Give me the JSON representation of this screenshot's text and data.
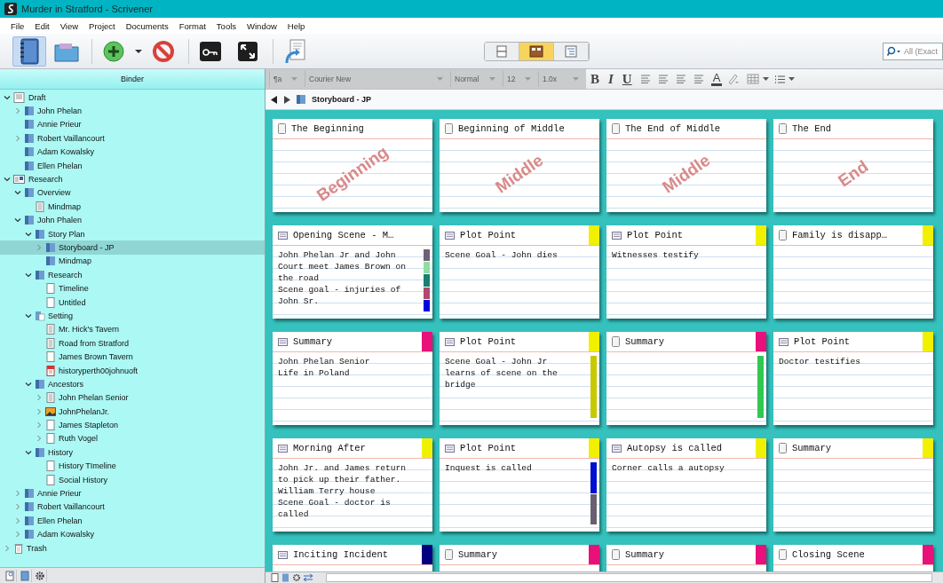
{
  "window": {
    "title": "Murder in Stratford - Scrivener"
  },
  "menu": [
    "File",
    "Edit",
    "View",
    "Project",
    "Documents",
    "Format",
    "Tools",
    "Window",
    "Help"
  ],
  "toolbar": {
    "tools": [
      {
        "kind": "binder",
        "selected": true
      },
      {
        "kind": "collections",
        "selected": false
      },
      {
        "kind": "add",
        "selected": false
      },
      {
        "kind": "caret",
        "selected": false
      },
      {
        "kind": "delete",
        "selected": false
      },
      {
        "kind": "keywords",
        "selected": false
      },
      {
        "kind": "fullscreen",
        "selected": false
      },
      {
        "kind": "compile",
        "selected": false
      }
    ],
    "view_modes": [
      {
        "kind": "scrivenings",
        "selected": false
      },
      {
        "kind": "corkboard",
        "selected": true
      },
      {
        "kind": "outliner",
        "selected": false
      }
    ],
    "search": {
      "placeholder": "All (Exact"
    }
  },
  "format_bar": {
    "paragraph": "¶a",
    "font": "Courier New",
    "style": "Normal",
    "size": "12",
    "spacing": "1.0x",
    "bold": "B",
    "italic": "I",
    "underline": "U",
    "text_color": "A"
  },
  "binder": {
    "title": "Binder",
    "items": [
      {
        "label": "Draft",
        "kind": "draft",
        "expanded": true,
        "selected": false,
        "children": [
          {
            "label": "John Phelan",
            "kind": "folder",
            "expanded": false,
            "selected": false
          },
          {
            "label": "Annie Prieur",
            "kind": "folder",
            "selected": false
          },
          {
            "label": "Robert Vaillancourt",
            "kind": "folder",
            "expanded": false,
            "selected": false
          },
          {
            "label": "Adam Kowalsky",
            "kind": "folder",
            "selected": false
          },
          {
            "label": "Ellen Phelan",
            "kind": "folder",
            "selected": false
          }
        ]
      },
      {
        "label": "Research",
        "kind": "research",
        "expanded": true,
        "selected": false,
        "children": [
          {
            "label": "Overview",
            "kind": "folder",
            "expanded": true,
            "selected": false,
            "children": [
              {
                "label": "Mindmap",
                "kind": "text",
                "selected": false
              }
            ]
          },
          {
            "label": "John Phalen",
            "kind": "folder",
            "expanded": true,
            "selected": false,
            "children": [
              {
                "label": "Story Plan",
                "kind": "folder",
                "expanded": true,
                "selected": false,
                "children": [
                  {
                    "label": "Storyboard - JP",
                    "kind": "folder",
                    "expanded": false,
                    "selected": true
                  },
                  {
                    "label": "Mindmap",
                    "kind": "folder",
                    "selected": false
                  }
                ]
              },
              {
                "label": "Research",
                "kind": "folder",
                "expanded": true,
                "selected": false,
                "children": [
                  {
                    "label": "Timeline",
                    "kind": "page",
                    "selected": false
                  },
                  {
                    "label": "Untitled",
                    "kind": "page",
                    "selected": false
                  }
                ]
              },
              {
                "label": "Setting",
                "kind": "textfolder",
                "expanded": true,
                "selected": false,
                "children": [
                  {
                    "label": "Mr. Hick's Tavern",
                    "kind": "text",
                    "selected": false
                  },
                  {
                    "label": "Road from Stratford",
                    "kind": "text",
                    "selected": false
                  },
                  {
                    "label": "James Brown Tavern",
                    "kind": "page",
                    "selected": false
                  },
                  {
                    "label": "historyperth00johnuoft",
                    "kind": "pdf",
                    "selected": false
                  }
                ]
              },
              {
                "label": "Ancestors",
                "kind": "folder",
                "expanded": true,
                "selected": false,
                "children": [
                  {
                    "label": "John Phelan Senior",
                    "kind": "text",
                    "expanded": false,
                    "selected": false
                  },
                  {
                    "label": "JohnPhelanJr.",
                    "kind": "image",
                    "expanded": false,
                    "selected": false
                  },
                  {
                    "label": "James Stapleton",
                    "kind": "page",
                    "expanded": false,
                    "selected": false
                  },
                  {
                    "label": "Ruth Vogel",
                    "kind": "page",
                    "expanded": false,
                    "selected": false
                  }
                ]
              },
              {
                "label": "History",
                "kind": "folder",
                "expanded": true,
                "selected": false,
                "children": [
                  {
                    "label": "History TImeline",
                    "kind": "page",
                    "selected": false
                  },
                  {
                    "label": "Social History",
                    "kind": "page",
                    "selected": false
                  }
                ]
              }
            ]
          },
          {
            "label": "Annie Prieur",
            "kind": "folder",
            "expanded": false,
            "selected": false
          },
          {
            "label": "Robert Vaillancourt",
            "kind": "folder",
            "expanded": false,
            "selected": false
          },
          {
            "label": "Ellen Phelan",
            "kind": "folder",
            "expanded": false,
            "selected": false
          },
          {
            "label": "Adam Kowalsky",
            "kind": "folder",
            "expanded": false,
            "selected": false
          }
        ]
      },
      {
        "label": "Trash",
        "kind": "trash",
        "expanded": false,
        "selected": false
      }
    ]
  },
  "editor": {
    "path": "Storyboard - JP",
    "cards": [
      {
        "title": "The Beginning",
        "kind": "page",
        "stamp": "Beginning"
      },
      {
        "title": "Beginning of Middle",
        "kind": "page",
        "stamp": "Middle"
      },
      {
        "title": "The End of Middle",
        "kind": "page",
        "stamp": "Middle"
      },
      {
        "title": "The End",
        "kind": "page",
        "stamp": "End"
      },
      {
        "title": "Opening Scene - M…",
        "kind": "index",
        "lines": [
          "John Phelan Jr and John",
          "Court meet James Brown on",
          "the road",
          "Scene goal - injuries of",
          "John Sr."
        ],
        "keywords": [
          {
            "color": "#6e6078"
          },
          {
            "color": "#8ee0a0"
          },
          {
            "color": "#1a8070"
          },
          {
            "color": "#b04870"
          },
          {
            "color": "#0000e0"
          }
        ]
      },
      {
        "title": "Plot Point",
        "kind": "index",
        "color": "#f0f000",
        "lines": [
          "Scene Goal - John dies"
        ]
      },
      {
        "title": "Plot Point",
        "kind": "index",
        "color": "#f0f000",
        "lines": [
          "Witnesses testify"
        ]
      },
      {
        "title": "Family is disapp…",
        "kind": "page",
        "color": "#f0f000"
      },
      {
        "title": "Summary",
        "kind": "index",
        "color": "#e8107a",
        "lines": [
          "John Phelan Senior",
          "Life in Poland"
        ]
      },
      {
        "title": "Plot Point",
        "kind": "index",
        "color": "#f0f000",
        "lines": [
          "Scene Goal - John Jr",
          "learns of scene on the",
          "bridge"
        ],
        "keywords": [
          {
            "color": "#c8c800"
          }
        ]
      },
      {
        "title": "Summary",
        "kind": "page",
        "color": "#e8107a",
        "keywords": [
          {
            "color": "#30c850"
          }
        ]
      },
      {
        "title": "Plot Point",
        "kind": "index",
        "color": "#f0f000",
        "lines": [
          "Doctor testifies"
        ]
      },
      {
        "title": "Morning After",
        "kind": "index",
        "color": "#f0f000",
        "lines": [
          "John Jr. and James return",
          "to pick up their father.",
          "William Terry house",
          "Scene Goal - doctor is",
          "called"
        ]
      },
      {
        "title": "Plot Point",
        "kind": "index",
        "color": "#f0f000",
        "lines": [
          "Inquest is called"
        ],
        "keywords": [
          {
            "color": "#0010d0"
          },
          {
            "color": "#686070"
          }
        ]
      },
      {
        "title": "Autopsy is called",
        "kind": "index",
        "color": "#f0f000",
        "lines": [
          "Corner calls a autopsy"
        ]
      },
      {
        "title": "Summary",
        "kind": "page",
        "color": "#f0f000"
      },
      {
        "title": "Inciting Incident",
        "kind": "index",
        "color": "#000080"
      },
      {
        "title": "Summary",
        "kind": "page",
        "color": "#e8107a"
      },
      {
        "title": "Summary",
        "kind": "page",
        "color": "#e8107a"
      },
      {
        "title": "Closing Scene",
        "kind": "page",
        "color": "#e8107a"
      }
    ]
  }
}
